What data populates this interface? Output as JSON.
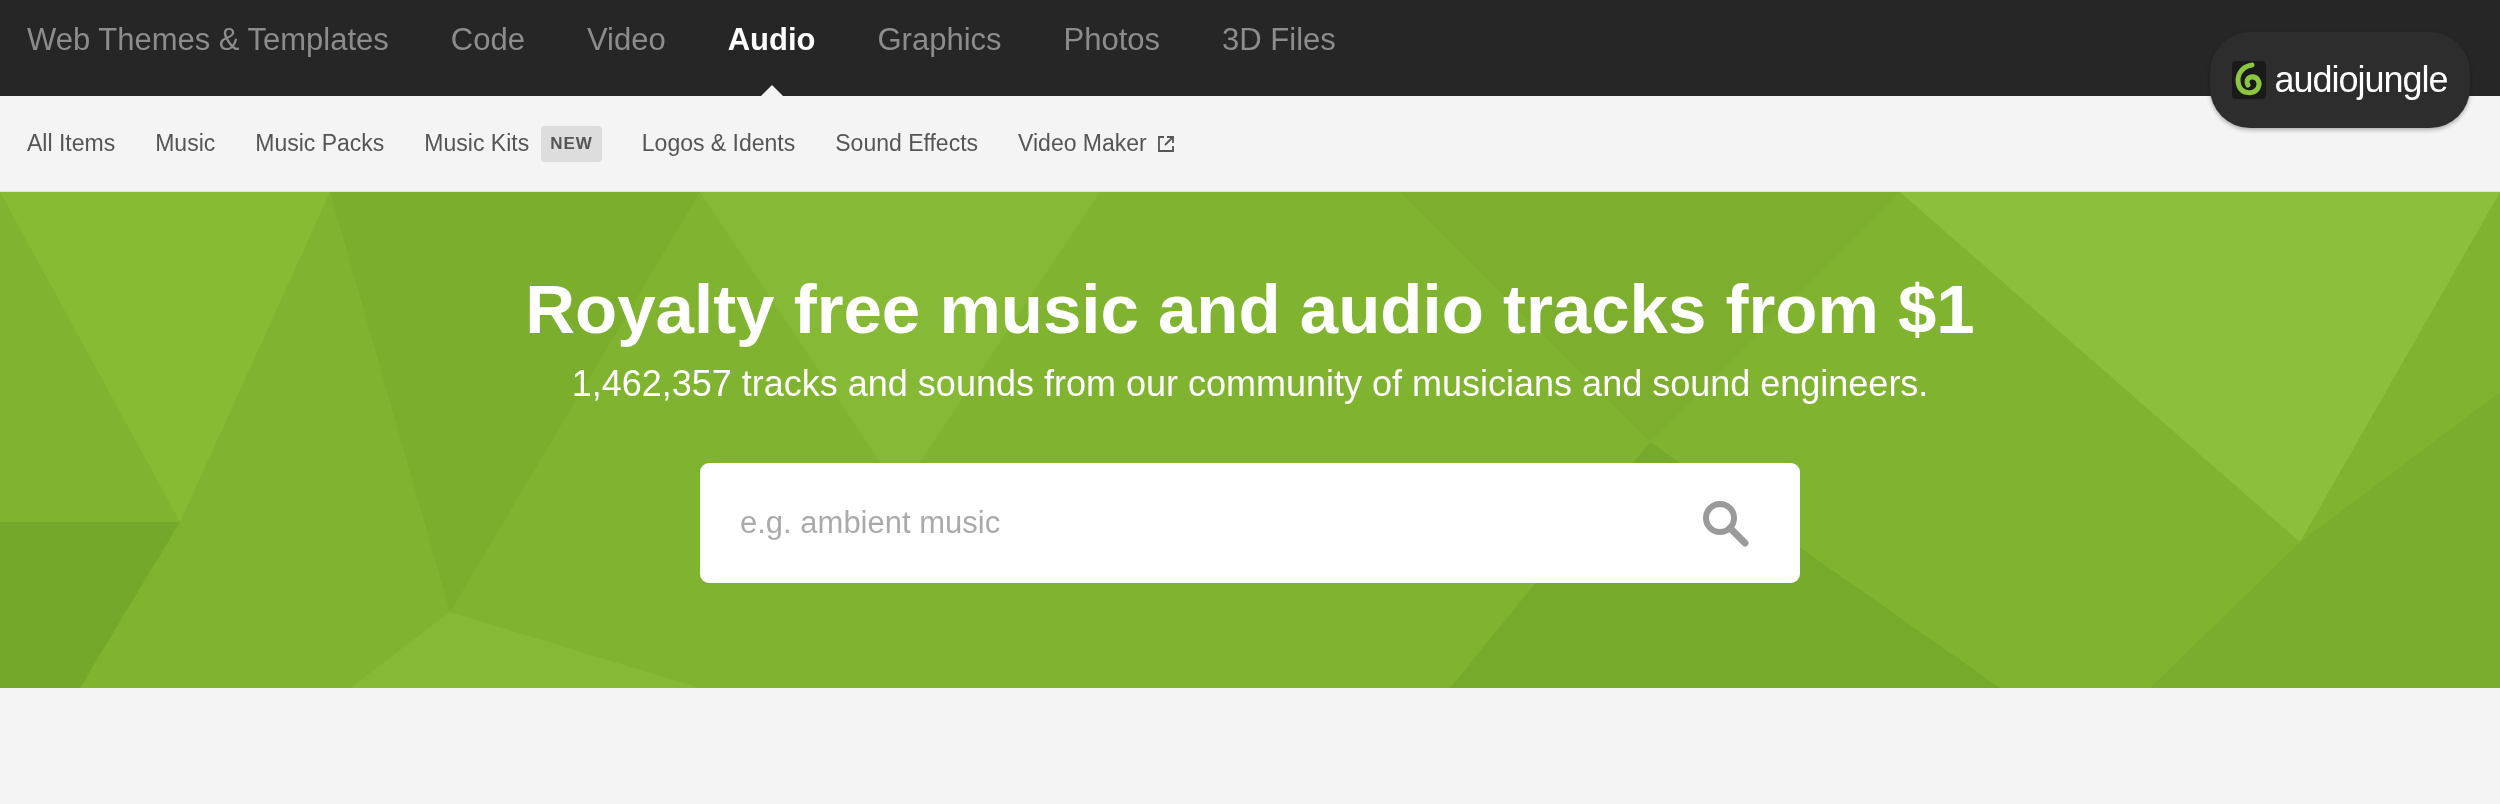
{
  "top_nav": [
    {
      "label": "Web Themes & Templates",
      "selected": false
    },
    {
      "label": "Code",
      "selected": false
    },
    {
      "label": "Video",
      "selected": false
    },
    {
      "label": "Audio",
      "selected": true
    },
    {
      "label": "Graphics",
      "selected": false
    },
    {
      "label": "Photos",
      "selected": false
    },
    {
      "label": "3D Files",
      "selected": false
    }
  ],
  "logo": {
    "text": "audiojungle"
  },
  "sub_nav": [
    {
      "label": "All Items"
    },
    {
      "label": "Music"
    },
    {
      "label": "Music Packs"
    },
    {
      "label": "Music Kits",
      "badge": "NEW"
    },
    {
      "label": "Logos & Idents"
    },
    {
      "label": "Sound Effects"
    },
    {
      "label": "Video Maker",
      "external": true
    }
  ],
  "hero": {
    "title": "Royalty free music and audio tracks from $1",
    "subtitle": "1,462,357 tracks and sounds from our community of musicians and sound engineers.",
    "search": {
      "placeholder": "e.g. ambient music"
    }
  }
}
